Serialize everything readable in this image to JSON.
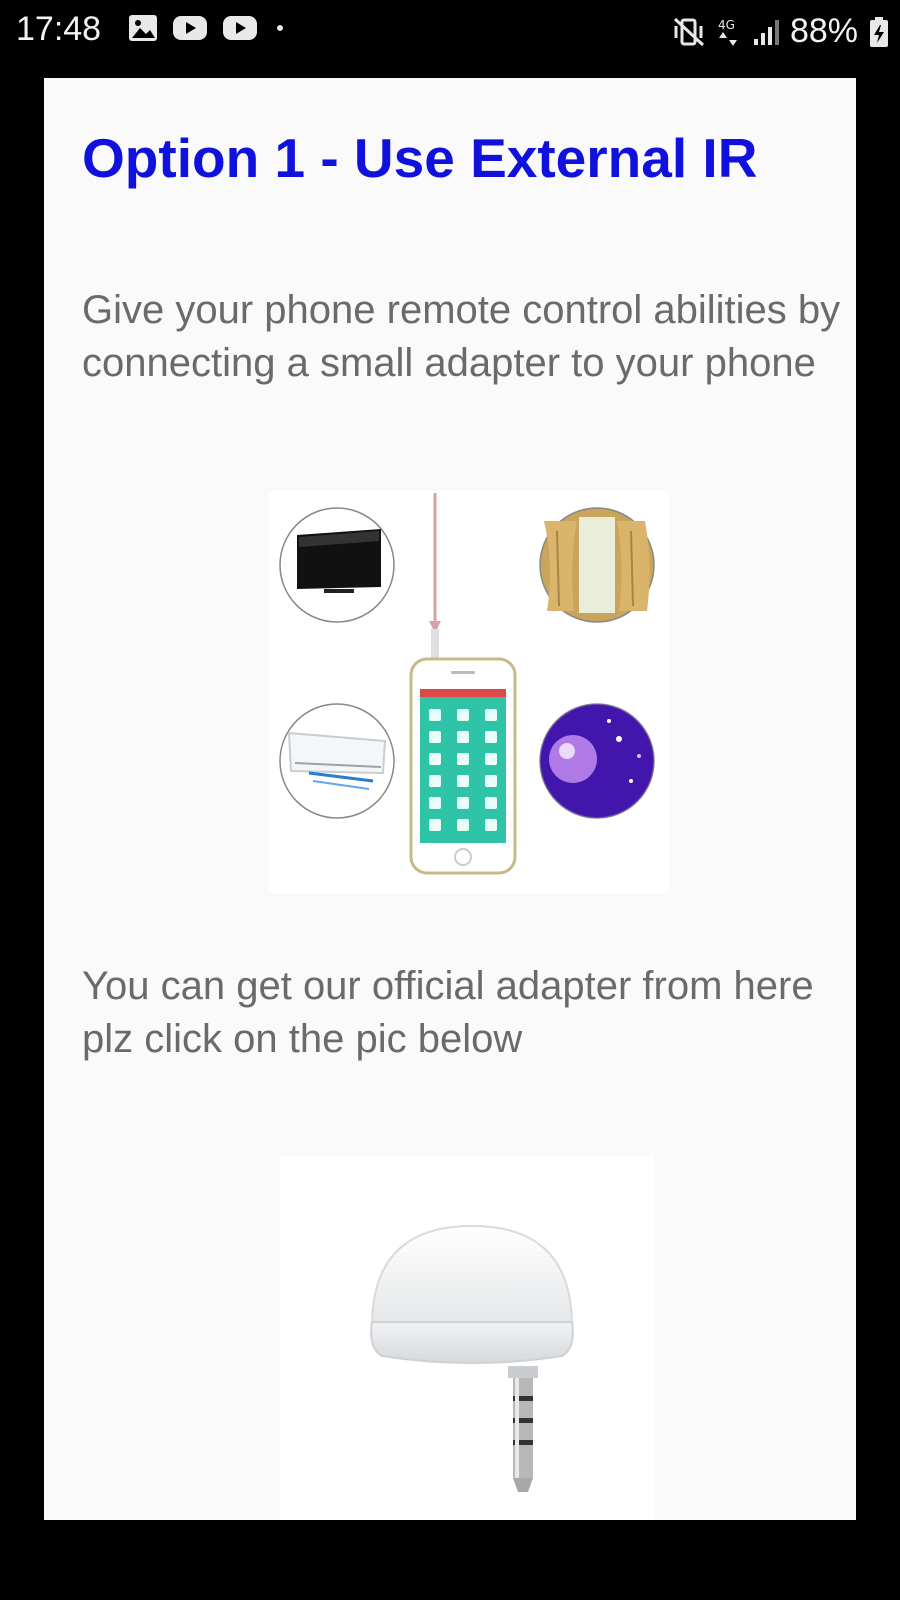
{
  "status_bar": {
    "time": "17:48",
    "battery": "88%",
    "left_icons": [
      "image-icon",
      "youtube-icon",
      "youtube-icon",
      "dot-icon"
    ],
    "right_icons": [
      "mute-vibrate-icon",
      "data-4g-icon",
      "signal-icon",
      "battery-icon"
    ]
  },
  "content": {
    "title": "Option 1 - Use External IR",
    "paragraph_1": "Give your phone remote control abilities by connecting a small adapter to your phone",
    "paragraph_2": "You can get our official adapter from here plz click on the pic below",
    "illustration_icons": [
      "tv-icon",
      "curtain-icon",
      "air-conditioner-icon",
      "disco-ball-icon",
      "phone-remote-app-icon"
    ],
    "adapter_image": "ir-adapter-icon"
  },
  "colors": {
    "title": "#1111dd",
    "body_text": "#6a6a6a",
    "card_bg": "#fafafa",
    "app_accent": "#2fc4a8"
  }
}
